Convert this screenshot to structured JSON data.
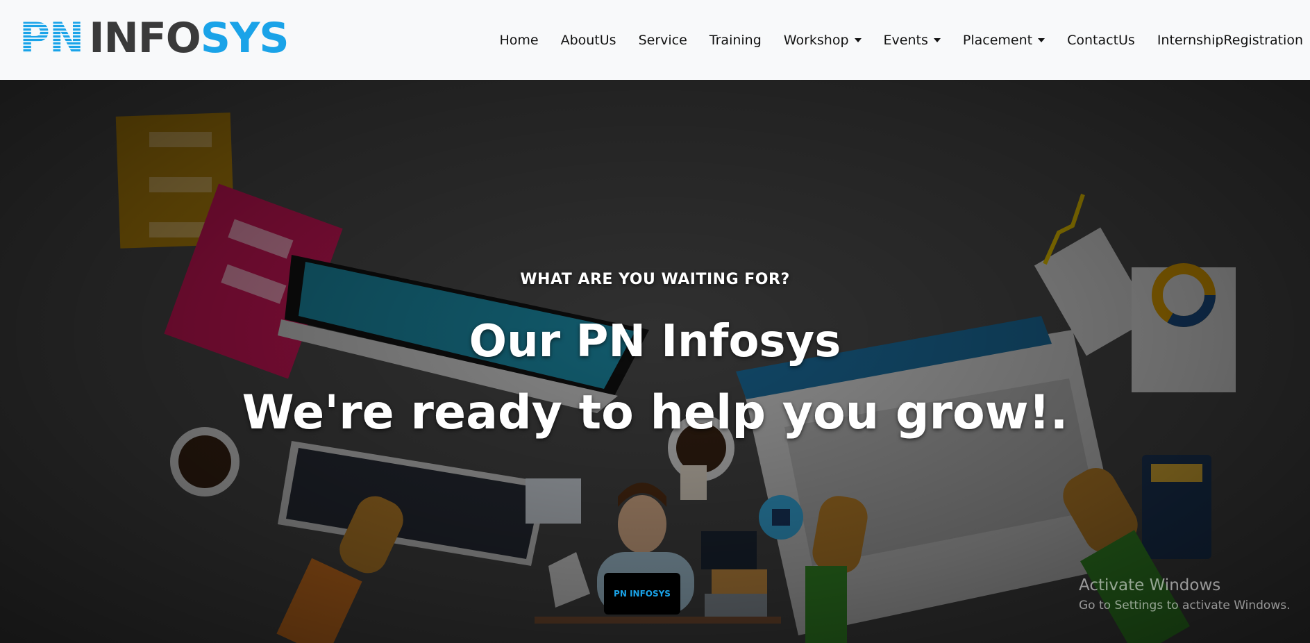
{
  "brand": {
    "logo_pn": "PN",
    "logo_info": "INFO",
    "logo_sys": "SYS"
  },
  "nav": {
    "items": [
      {
        "label": "Home",
        "dropdown": false
      },
      {
        "label": "AboutUs",
        "dropdown": false
      },
      {
        "label": "Service",
        "dropdown": false
      },
      {
        "label": "Training",
        "dropdown": false
      },
      {
        "label": "Workshop",
        "dropdown": true
      },
      {
        "label": "Events",
        "dropdown": true
      },
      {
        "label": "Placement",
        "dropdown": true
      },
      {
        "label": "ContactUs",
        "dropdown": false
      },
      {
        "label": "InternshipRegistration",
        "dropdown": false
      }
    ]
  },
  "hero": {
    "kicker": "WHAT ARE YOU WAITING FOR?",
    "headline_1": "Our PN Infosys",
    "headline_2": "We're ready to help you grow!.",
    "illustration_laptop_text": "PN INFOSYS"
  },
  "watermark": {
    "title": "Activate Windows",
    "subtitle": "Go to Settings to activate Windows."
  },
  "colors": {
    "brand_blue": "#1aa3e8",
    "brand_dark": "#3a3a3a",
    "navbar_bg": "#f8f9fa"
  }
}
